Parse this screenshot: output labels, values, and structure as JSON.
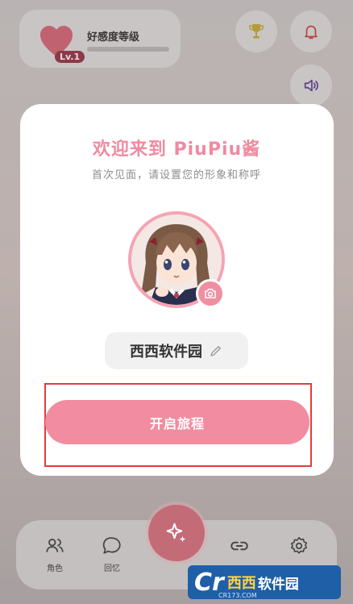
{
  "background": {
    "favor_title": "好感度等级",
    "level_badge": "Lv.1",
    "icons": [
      "heart-icon",
      "trophy-icon",
      "bell-icon",
      "speaker-icon"
    ],
    "nav": [
      {
        "name": "nav-role",
        "label": "角色",
        "icon": "people-icon"
      },
      {
        "name": "nav-memory",
        "label": "回忆",
        "icon": "chat-bubble-icon"
      },
      {
        "name": "nav-link",
        "label": "",
        "icon": "link-icon"
      },
      {
        "name": "nav-settings",
        "label": "",
        "icon": "gear-icon"
      }
    ]
  },
  "modal": {
    "title": "欢迎来到 PiuPiu酱",
    "subtitle": "首次见面，请设置您的形象和称呼",
    "name_value": "西西软件园",
    "start_button": "开启旅程"
  },
  "watermark": {
    "letter": "Cr",
    "brand": "西西",
    "text": "软件园",
    "url": "CR173.COM"
  },
  "colors": {
    "accent": "#f28da1",
    "title": "#f08aa0",
    "highlight": "#e43b3b"
  }
}
